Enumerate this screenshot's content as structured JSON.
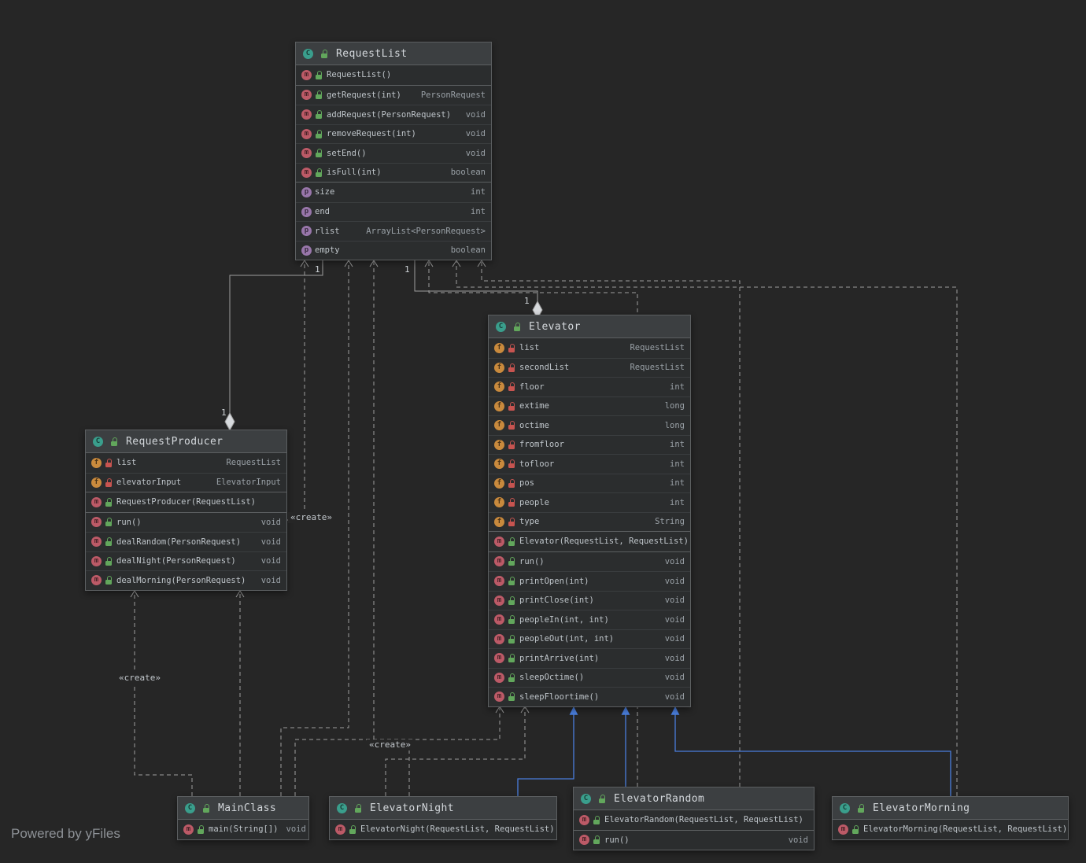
{
  "watermark": "Powered by yFiles",
  "colors": {
    "background": "#262626",
    "box_background": "#2b2d2e",
    "header_background": "#3c3f41",
    "box_border": "#5c5f61",
    "dependency_edge": "#9d9d9d",
    "inheritance_edge": "#4a7edd",
    "class_icon": "#3a9e8c",
    "method_icon": "#bc5a67",
    "field_icon": "#c98a3d",
    "property_icon": "#9876aa",
    "public_icon": "#62a75c",
    "private_icon": "#c75450"
  },
  "icons": {
    "class": {
      "letter": "C"
    },
    "method": {
      "letter": "m"
    },
    "field": {
      "letter": "f"
    },
    "property": {
      "letter": "p"
    }
  },
  "edge_labels": {
    "create": [
      "«create»",
      "«create»",
      "«create»"
    ],
    "multiplicity": [
      "1",
      "1",
      "1",
      "1"
    ]
  },
  "classes": {
    "requestList": {
      "title": "RequestList",
      "sections": [
        {
          "rows": [
            {
              "kind": "method",
              "vis": "public",
              "name": "RequestList()",
              "type": ""
            }
          ]
        },
        {
          "rows": [
            {
              "kind": "method",
              "vis": "public",
              "name": "getRequest(int)",
              "type": "PersonRequest"
            },
            {
              "kind": "method",
              "vis": "public",
              "name": "addRequest(PersonRequest)",
              "type": "void"
            },
            {
              "kind": "method",
              "vis": "public",
              "name": "removeRequest(int)",
              "type": "void"
            },
            {
              "kind": "method",
              "vis": "public",
              "name": "setEnd()",
              "type": "void"
            },
            {
              "kind": "method",
              "vis": "public",
              "name": "isFull(int)",
              "type": "boolean"
            }
          ]
        },
        {
          "rows": [
            {
              "kind": "property",
              "name": "size",
              "type": "int"
            },
            {
              "kind": "property",
              "name": "end",
              "type": "int"
            },
            {
              "kind": "property",
              "name": "rlist",
              "type": "ArrayList<PersonRequest>"
            },
            {
              "kind": "property",
              "name": "empty",
              "type": "boolean"
            }
          ]
        }
      ]
    },
    "elevator": {
      "title": "Elevator",
      "sections": [
        {
          "rows": [
            {
              "kind": "field",
              "vis": "private",
              "name": "list",
              "type": "RequestList"
            },
            {
              "kind": "field",
              "vis": "private",
              "name": "secondList",
              "type": "RequestList"
            },
            {
              "kind": "field",
              "vis": "private",
              "name": "floor",
              "type": "int"
            },
            {
              "kind": "field",
              "vis": "private",
              "name": "extime",
              "type": "long"
            },
            {
              "kind": "field",
              "vis": "private",
              "name": "octime",
              "type": "long"
            },
            {
              "kind": "field",
              "vis": "private",
              "name": "fromfloor",
              "type": "int"
            },
            {
              "kind": "field",
              "vis": "private",
              "name": "tofloor",
              "type": "int"
            },
            {
              "kind": "field",
              "vis": "private",
              "name": "pos",
              "type": "int"
            },
            {
              "kind": "field",
              "vis": "private",
              "name": "people",
              "type": "int"
            },
            {
              "kind": "field",
              "vis": "private",
              "name": "type",
              "type": "String"
            }
          ]
        },
        {
          "rows": [
            {
              "kind": "method",
              "vis": "public",
              "name": "Elevator(RequestList, RequestList)",
              "type": ""
            }
          ]
        },
        {
          "rows": [
            {
              "kind": "method",
              "vis": "public",
              "name": "run()",
              "type": "void"
            },
            {
              "kind": "method",
              "vis": "public",
              "name": "printOpen(int)",
              "type": "void"
            },
            {
              "kind": "method",
              "vis": "public",
              "name": "printClose(int)",
              "type": "void"
            },
            {
              "kind": "method",
              "vis": "public",
              "name": "peopleIn(int, int)",
              "type": "void"
            },
            {
              "kind": "method",
              "vis": "public",
              "name": "peopleOut(int, int)",
              "type": "void"
            },
            {
              "kind": "method",
              "vis": "public",
              "name": "printArrive(int)",
              "type": "void"
            },
            {
              "kind": "method",
              "vis": "public",
              "name": "sleepOctime()",
              "type": "void"
            },
            {
              "kind": "method",
              "vis": "public",
              "name": "sleepFloortime()",
              "type": "void"
            }
          ]
        }
      ]
    },
    "requestProducer": {
      "title": "RequestProducer",
      "sections": [
        {
          "rows": [
            {
              "kind": "field",
              "vis": "private",
              "name": "list",
              "type": "RequestList"
            },
            {
              "kind": "field",
              "vis": "private",
              "name": "elevatorInput",
              "type": "ElevatorInput"
            }
          ]
        },
        {
          "rows": [
            {
              "kind": "method",
              "vis": "public",
              "name": "RequestProducer(RequestList)",
              "type": ""
            }
          ]
        },
        {
          "rows": [
            {
              "kind": "method",
              "vis": "public",
              "name": "run()",
              "type": "void"
            },
            {
              "kind": "method",
              "vis": "public",
              "name": "dealRandom(PersonRequest)",
              "type": "void"
            },
            {
              "kind": "method",
              "vis": "public",
              "name": "dealNight(PersonRequest)",
              "type": "void"
            },
            {
              "kind": "method",
              "vis": "public",
              "name": "dealMorning(PersonRequest)",
              "type": "void"
            }
          ]
        }
      ]
    },
    "mainClass": {
      "title": "MainClass",
      "sections": [
        {
          "rows": [
            {
              "kind": "method",
              "vis": "public",
              "name": "main(String[])",
              "type": "void"
            }
          ]
        }
      ]
    },
    "elevatorNight": {
      "title": "ElevatorNight",
      "sections": [
        {
          "rows": [
            {
              "kind": "method",
              "vis": "public",
              "name": "ElevatorNight(RequestList, RequestList)",
              "type": ""
            }
          ]
        }
      ]
    },
    "elevatorRandom": {
      "title": "ElevatorRandom",
      "sections": [
        {
          "rows": [
            {
              "kind": "method",
              "vis": "public",
              "name": "ElevatorRandom(RequestList, RequestList)",
              "type": ""
            }
          ]
        },
        {
          "rows": [
            {
              "kind": "method",
              "vis": "public",
              "name": "run()",
              "type": "void"
            }
          ]
        }
      ]
    },
    "elevatorMorning": {
      "title": "ElevatorMorning",
      "sections": [
        {
          "rows": [
            {
              "kind": "method",
              "vis": "public",
              "name": "ElevatorMorning(RequestList, RequestList)",
              "type": ""
            }
          ]
        }
      ]
    }
  }
}
